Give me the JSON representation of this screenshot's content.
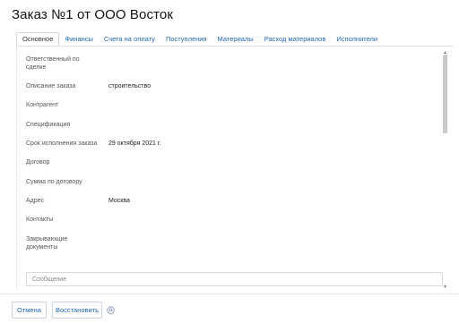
{
  "header": {
    "title": "Заказ №1 от ООО Восток"
  },
  "tabs": [
    {
      "label": "Основное",
      "active": true
    },
    {
      "label": "Финансы"
    },
    {
      "label": "Счета на оплату"
    },
    {
      "label": "Поступления"
    },
    {
      "label": "Материалы"
    },
    {
      "label": "Расход материалов"
    },
    {
      "label": "Исполнители"
    }
  ],
  "fields": [
    {
      "label": "Ответственный по сделке",
      "value": ""
    },
    {
      "label": "Описание заказа",
      "value": "строительство"
    },
    {
      "label": "Контрагент",
      "value": ""
    },
    {
      "label": "Спецификация",
      "value": ""
    },
    {
      "label": "Срок исполнения заказа",
      "value": "29 октября 2021 г."
    },
    {
      "label": "Договор",
      "value": ""
    },
    {
      "label": "Сумма по договору",
      "value": ""
    },
    {
      "label": "Адрес",
      "value": "Москва"
    },
    {
      "label": "Контакты",
      "value": ""
    },
    {
      "label": "Закрывающие документы",
      "value": ""
    }
  ],
  "message": {
    "placeholder": "Сообщение"
  },
  "footer": {
    "cancel_label": "Отмена",
    "restore_label": "Восстановить"
  },
  "icons": {
    "settings": "gear-icon",
    "scroll_up": "chevron-up-icon",
    "scroll_down": "chevron-down-icon"
  },
  "colors": {
    "link": "#2067b0",
    "border": "#d9d9d9"
  }
}
